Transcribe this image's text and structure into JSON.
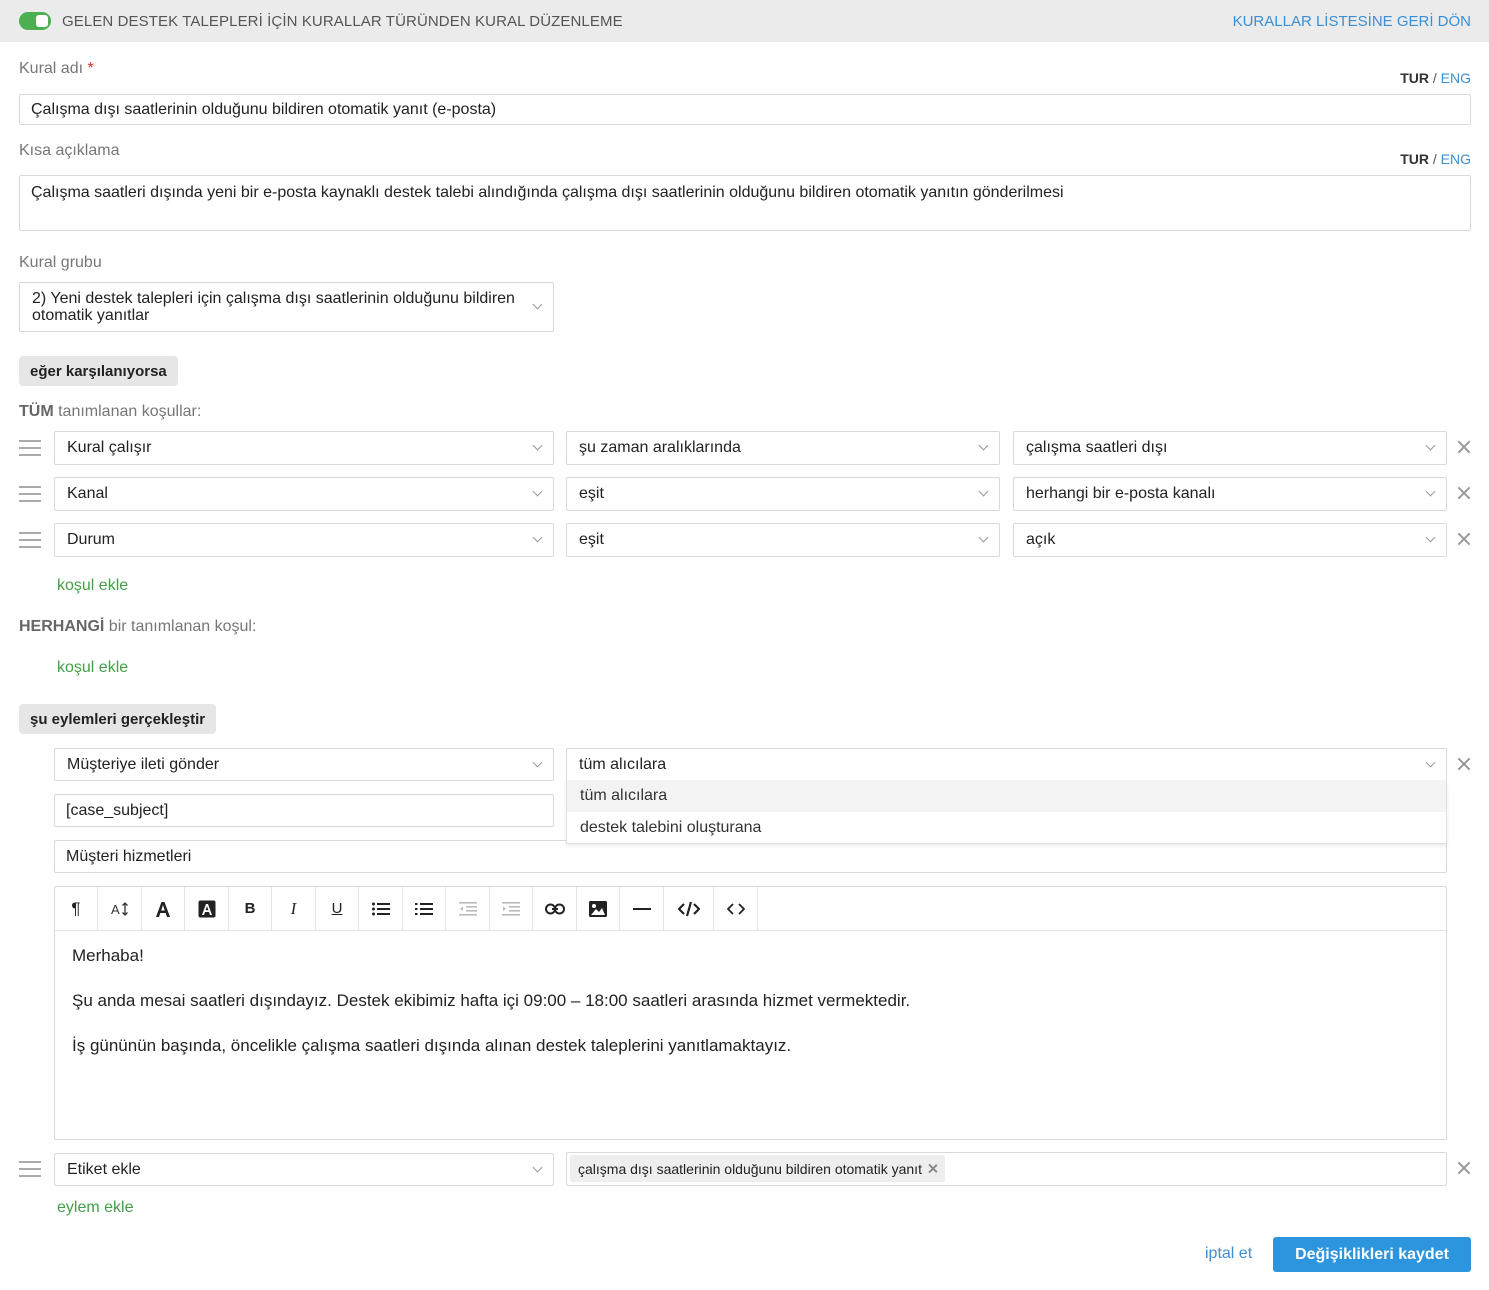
{
  "header": {
    "toggle_on": true,
    "title": "GELEN DESTEK TALEPLERİ İÇİN KURALLAR TÜRÜNDEN KURAL DÜZENLEME",
    "back_link": "KURALLAR LİSTESİNE GERİ DÖN"
  },
  "colors": {
    "accent_blue": "#2c95dd",
    "link_green": "#43a047",
    "toggle_green": "#4caf50",
    "required_red": "#d9302b"
  },
  "form": {
    "rule_name_label": "Kural adı",
    "required_mark": "*",
    "lang_current": "TUR",
    "lang_sep": "/",
    "lang_alt": "ENG",
    "rule_name_value": "Çalışma dışı saatlerinin olduğunu bildiren otomatik yanıt (e-posta)",
    "short_desc_label": "Kısa açıklama",
    "short_desc_value": "Çalışma saatleri dışında yeni bir e-posta kaynaklı destek talebi alındığında çalışma dışı saatlerinin olduğunu bildiren otomatik yanıtın gönderilmesi",
    "rule_group_label": "Kural grubu",
    "rule_group_value": "2) Yeni destek talepleri için çalışma dışı saatlerinin olduğunu bildiren otomatik yanıtlar"
  },
  "conditions": {
    "section_label": "eğer karşılanıyorsa",
    "all_prefix": "TÜM",
    "all_suffix": "tanımlanan koşullar:",
    "rows": [
      {
        "field": "Kural çalışır",
        "operator": "şu zaman aralıklarında",
        "value": "çalışma saatleri dışı"
      },
      {
        "field": "Kanal",
        "operator": "eşit",
        "value": "herhangi bir e-posta kanalı"
      },
      {
        "field": "Durum",
        "operator": "eşit",
        "value": "açık"
      }
    ],
    "add_condition": "koşul ekle",
    "any_prefix": "HERHANGİ",
    "any_suffix": "bir tanımlanan koşul:",
    "add_condition_any": "koşul ekle"
  },
  "actions": {
    "section_label": "şu eylemleri gerçekleştir",
    "send_action": "Müşteriye ileti gönder",
    "recipients_value": "tüm alıcılara",
    "recipients_options": [
      "tüm alıcılara",
      "destek talebini oluşturana"
    ],
    "subject_value": "[case_subject]",
    "sender_value": "Müşteri hizmetleri",
    "toolbar_icons": [
      "paragraph-icon",
      "font-size-icon",
      "font-color-icon",
      "highlight-icon",
      "bold-icon",
      "italic-icon",
      "underline-icon",
      "bullet-list-icon",
      "numbered-list-icon",
      "outdent-icon",
      "indent-icon",
      "link-icon",
      "image-icon",
      "horizontal-rule-icon",
      "code-view-icon",
      "source-icon"
    ],
    "toolbar_glyphs": {
      "paragraph": "¶",
      "bold": "B",
      "italic": "I",
      "underline": "U"
    },
    "message_lines": [
      "Merhaba!",
      "Şu anda mesai saatleri dışındayız. Destek ekibimiz hafta içi 09:00 – 18:00 saatleri arasında hizmet vermektedir.",
      "İş gününün başında, öncelikle çalışma saatleri dışında alınan destek taleplerini yanıtlamaktayız."
    ],
    "tag_action": "Etiket ekle",
    "tag_value": "çalışma dışı saatlerinin olduğunu bildiren otomatik yanıt",
    "add_action": "eylem ekle"
  },
  "footer": {
    "cancel": "iptal et",
    "save": "Değişiklikleri kaydet"
  }
}
